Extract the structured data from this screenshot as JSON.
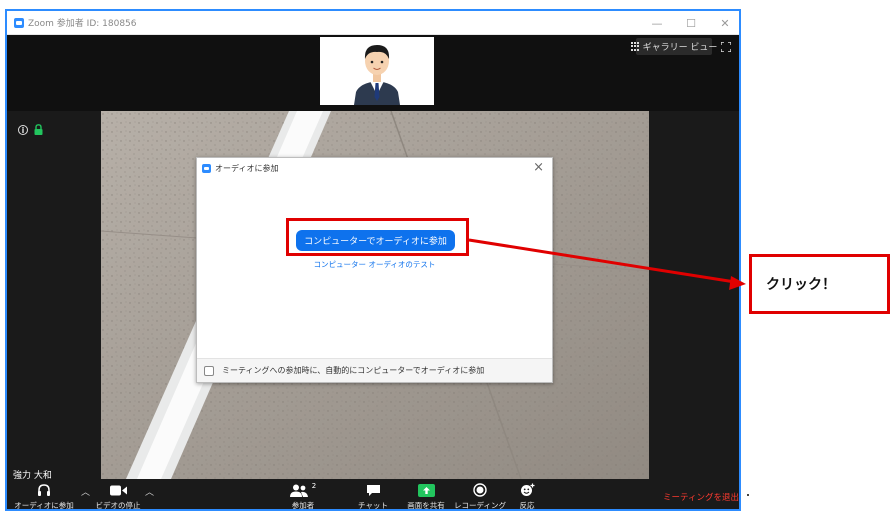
{
  "window": {
    "title": "Zoom 参加者 ID: 180856",
    "controls": {
      "minimize": "—",
      "maximize": "☐",
      "close": "✕"
    }
  },
  "top_bar": {
    "gallery_view_label": "ギャラリー ビュー"
  },
  "participant": {
    "name": "強力 大和"
  },
  "dialog": {
    "title": "オーディオに参加",
    "close_glyph": "×",
    "join_button_label": "コンピューターでオーディオに参加",
    "test_link_label": "コンピューター オーディオのテスト",
    "auto_join_checkbox_label": "ミーティングへの参加時に、自動的にコンピューターでオーディオに参加",
    "auto_join_checked": false
  },
  "toolbar": {
    "audio_label": "オーディオに参加",
    "video_label": "ビデオの停止",
    "participants_label": "参加者",
    "participants_count": "2",
    "chat_label": "チャット",
    "share_label": "画面を共有",
    "record_label": "レコーディング",
    "reactions_label": "反応",
    "end_label": "ミーティングを退出"
  },
  "annotation": {
    "callout_text": "クリック！"
  },
  "colors": {
    "accent_blue": "#0e72ed",
    "window_border": "#2d8cff",
    "annotation_red": "#e00000",
    "share_green": "#22c55e",
    "end_red": "#ff3b30",
    "meeting_bg": "#1a1a1a"
  },
  "icons": {
    "app": "zoom-camera-icon",
    "gallery": "grid-icon",
    "fullscreen": "fullscreen-icon",
    "info": "info-icon",
    "lock": "lock-icon",
    "audio": "headphones-icon",
    "video": "video-camera-icon",
    "participants": "people-icon",
    "chat": "chat-bubble-icon",
    "share": "share-screen-icon",
    "record": "record-icon",
    "reactions": "smiley-icon"
  }
}
